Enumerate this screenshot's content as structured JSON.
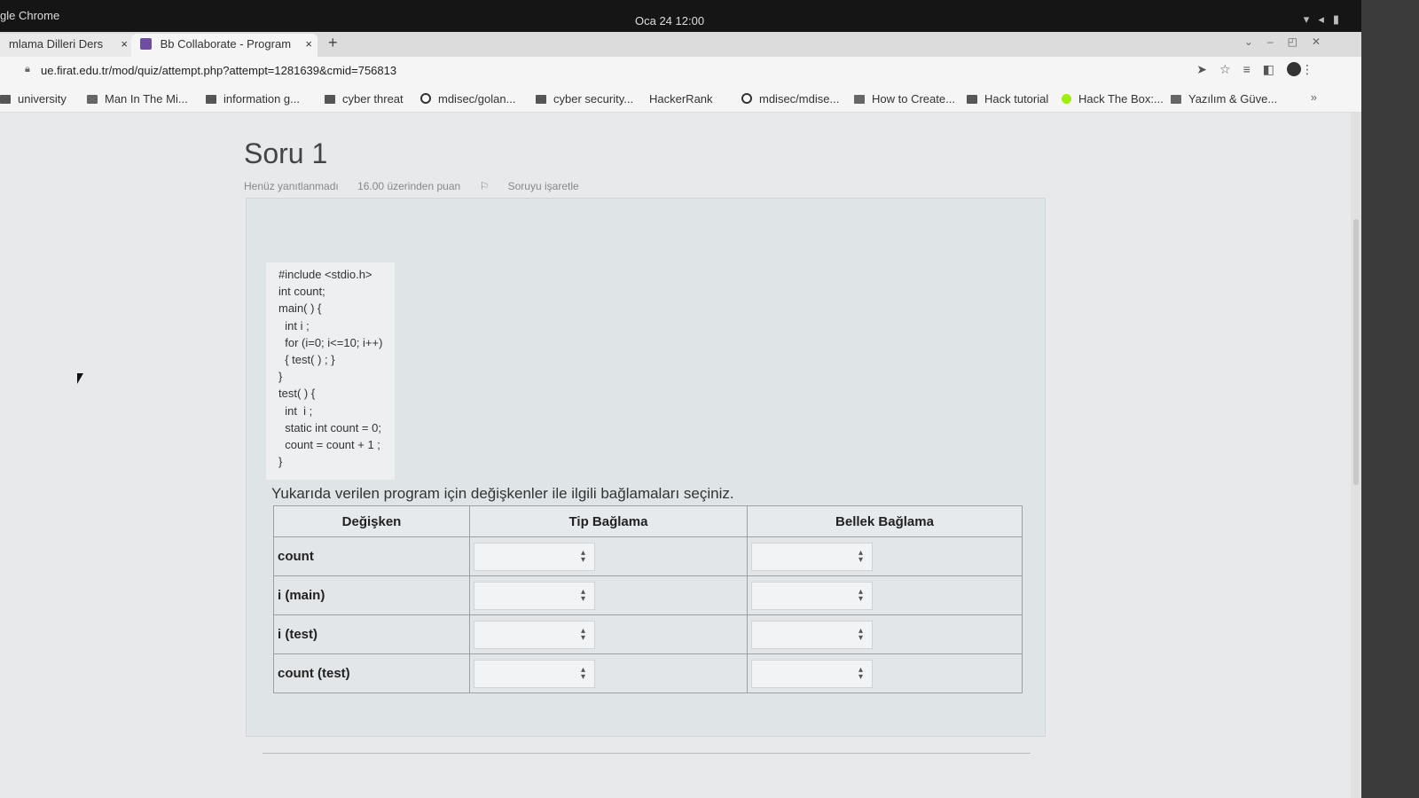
{
  "os": {
    "app_menu": "gle Chrome",
    "clock": "Oca 24  12:00"
  },
  "tabs": [
    {
      "label": "mlama Dilleri Ders",
      "close": "×"
    },
    {
      "label": "Bb Collaborate - Program",
      "close": "×"
    }
  ],
  "newtab": "+",
  "address": {
    "url": "ue.firat.edu.tr/mod/quiz/attempt.php?attempt=1281639&cmid=756813"
  },
  "bookmarks": [
    {
      "label": "university",
      "icon": "folder-icon"
    },
    {
      "label": "Man In The Mi...",
      "icon": "site-icon"
    },
    {
      "label": "information g...",
      "icon": "folder-icon"
    },
    {
      "label": "cyber threat",
      "icon": "folder-icon"
    },
    {
      "label": "mdisec/golan...",
      "icon": "github-icon"
    },
    {
      "label": "cyber security...",
      "icon": "folder-icon"
    },
    {
      "label": "HackerRank",
      "icon": "hackerrank-icon"
    },
    {
      "label": "mdisec/mdise...",
      "icon": "github-icon"
    },
    {
      "label": "How to Create...",
      "icon": "site-icon"
    },
    {
      "label": "Hack tutorial",
      "icon": "folder-icon"
    },
    {
      "label": "Hack The Box:...",
      "icon": "hackthebox-icon"
    },
    {
      "label": "Yazılım & Güve...",
      "icon": "site-icon"
    }
  ],
  "bookmarks_more": "»",
  "question": {
    "title": "Soru 1",
    "status": "Henüz yanıtlanmadı",
    "points": "16.00 üzerinden puan",
    "flag_label": "Soruyu işaretle",
    "code_lines": [
      "#include <stdio.h>",
      "int count;",
      "main( ) {",
      "  int i ;",
      "  for (i=0; i<=10; i++)",
      "  { test( ) ; }",
      "}",
      "test( ) {",
      "  int  i ;",
      "  static int count = 0;",
      "  count = count + 1 ;",
      "}"
    ],
    "prompt": "Yukarıda verilen program için değişkenler ile ilgili bağlamaları seçiniz.",
    "columns": [
      "Değişken",
      "Tip Bağlama",
      "Bellek Bağlama"
    ],
    "rows": [
      {
        "variable": "count",
        "tip": "",
        "bellek": ""
      },
      {
        "variable": "i (main)",
        "tip": "",
        "bellek": ""
      },
      {
        "variable": "i (test)",
        "tip": "",
        "bellek": ""
      },
      {
        "variable": "count (test)",
        "tip": "",
        "bellek": ""
      }
    ]
  }
}
